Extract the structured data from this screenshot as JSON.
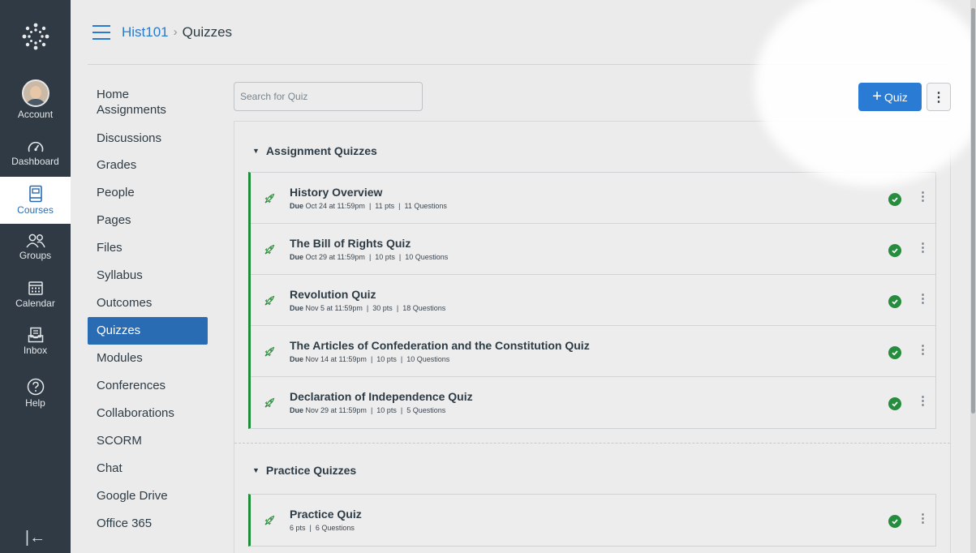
{
  "global_nav": {
    "items": [
      {
        "label": "Account",
        "icon": "avatar"
      },
      {
        "label": "Dashboard",
        "icon": "speedometer-icon"
      },
      {
        "label": "Courses",
        "icon": "book-icon"
      },
      {
        "label": "Groups",
        "icon": "users-icon"
      },
      {
        "label": "Calendar",
        "icon": "calendar-icon"
      },
      {
        "label": "Inbox",
        "icon": "inbox-icon"
      },
      {
        "label": "Help",
        "icon": "help-icon"
      }
    ],
    "active": "Courses",
    "collapse_glyph": "|←"
  },
  "header": {
    "course": "Hist101",
    "separator": "›",
    "current": "Quizzes"
  },
  "course_nav": {
    "items": [
      "Home",
      "Assignments",
      "Discussions",
      "Grades",
      "People",
      "Pages",
      "Files",
      "Syllabus",
      "Outcomes",
      "Quizzes",
      "Modules",
      "Conferences",
      "Collaborations",
      "SCORM",
      "Chat",
      "Google Drive",
      "Office 365"
    ],
    "active": "Quizzes"
  },
  "toolbar": {
    "search_placeholder": "Search for Quiz",
    "add_quiz_plus": "+",
    "add_quiz_label": "Quiz",
    "more_glyph": "⋮"
  },
  "groups": {
    "assignment": {
      "title": "Assignment Quizzes",
      "quizzes": [
        {
          "title": "History Overview",
          "due_label": "Due",
          "due": "Oct 24 at 11:59pm",
          "points": "11 pts",
          "questions": "11 Questions",
          "published": true
        },
        {
          "title": "The Bill of Rights Quiz",
          "due_label": "Due",
          "due": "Oct 29 at 11:59pm",
          "points": "10 pts",
          "questions": "10 Questions",
          "published": true
        },
        {
          "title": "Revolution Quiz",
          "due_label": "Due",
          "due": "Nov 5 at 11:59pm",
          "points": "30 pts",
          "questions": "18 Questions",
          "published": true
        },
        {
          "title": "The Articles of Confederation and the Constitution Quiz",
          "due_label": "Due",
          "due": "Nov 14 at 11:59pm",
          "points": "10 pts",
          "questions": "10 Questions",
          "published": true
        },
        {
          "title": "Declaration of Independence Quiz",
          "due_label": "Due",
          "due": "Nov 29 at 11:59pm",
          "points": "10 pts",
          "questions": "5 Questions",
          "published": true
        }
      ]
    },
    "practice": {
      "title": "Practice Quizzes",
      "quizzes": [
        {
          "title": "Practice Quiz",
          "points": "6 pts",
          "questions": "6 Questions",
          "published": true
        }
      ]
    }
  },
  "meta_separator": "|",
  "colors": {
    "nav_bg": "#2f3a44",
    "link": "#2a7bcc",
    "primary_button": "#2a7bd4",
    "published": "#258d3d",
    "active_course_nav": "#2a6cb3"
  }
}
